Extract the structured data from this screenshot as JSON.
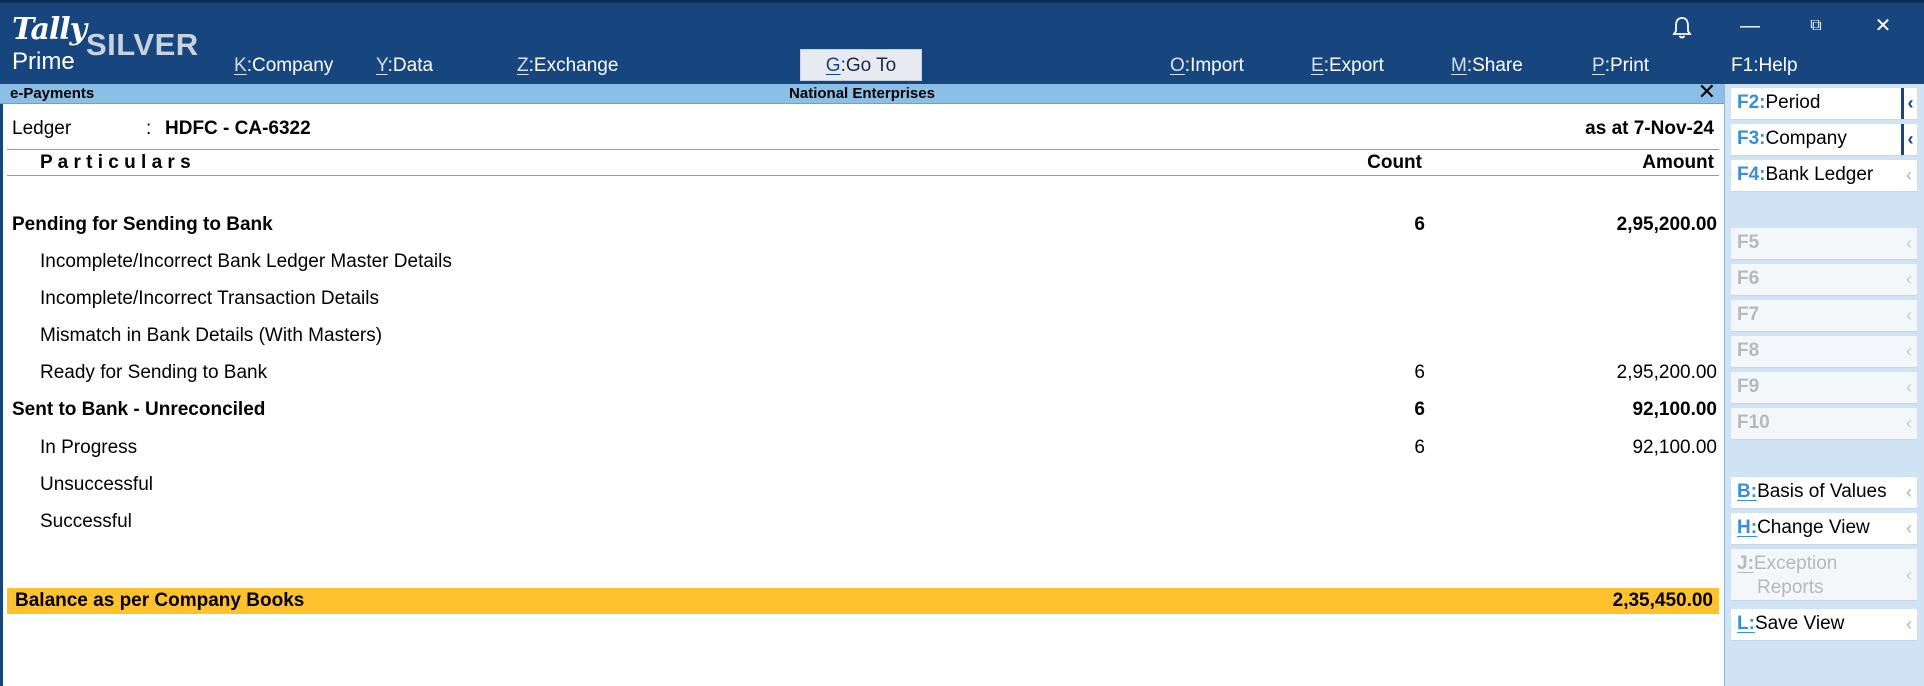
{
  "app": {
    "brand_top": "Tally",
    "brand_bottom": "Prime",
    "edition": "SILVER"
  },
  "window_controls": {
    "minimize": "—",
    "restore": "⧉",
    "close": "✕"
  },
  "menu": [
    {
      "key": "K",
      "label": "Company"
    },
    {
      "key": "Y",
      "label": "Data"
    },
    {
      "key": "Z",
      "label": "Exchange"
    },
    {
      "key": "G",
      "label": "Go To"
    },
    {
      "key": "O",
      "label": "Import"
    },
    {
      "key": "E",
      "label": "Export"
    },
    {
      "key": "M",
      "label": "Share"
    },
    {
      "key": "P",
      "label": "Print"
    },
    {
      "key": "F1",
      "label": "Help"
    }
  ],
  "titlebar": {
    "report": "e-Payments",
    "company": "National Enterprises",
    "close": "✕"
  },
  "ledger": {
    "label": "Ledger",
    "sep": ":",
    "value": "HDFC - CA-6322",
    "as_at": "as at 7-Nov-24"
  },
  "columns": {
    "particulars": "P a r t i c u l a r s",
    "count": "Count",
    "amount": "Amount"
  },
  "rows": [
    {
      "label": "Pending for Sending to Bank",
      "count": "6",
      "amount": "2,95,200.00"
    },
    {
      "label": "Incomplete/Incorrect Bank Ledger Master Details",
      "count": "",
      "amount": ""
    },
    {
      "label": "Incomplete/Incorrect Transaction Details",
      "count": "",
      "amount": ""
    },
    {
      "label": "Mismatch in Bank Details (With Masters)",
      "count": "",
      "amount": ""
    },
    {
      "label": "Ready for Sending to Bank",
      "count": "6",
      "amount": "2,95,200.00"
    },
    {
      "label": "Sent to Bank - Unreconciled",
      "count": "6",
      "amount": "92,100.00"
    },
    {
      "label": "In Progress",
      "count": "6",
      "amount": "92,100.00"
    },
    {
      "label": "Unsuccessful",
      "count": "",
      "amount": ""
    },
    {
      "label": "Successful",
      "count": "",
      "amount": ""
    }
  ],
  "total": {
    "label": "Balance as per Company Books",
    "amount": "2,35,450.00"
  },
  "sidebar": [
    {
      "key": "F2:",
      "label": "Period",
      "arrow": "‹"
    },
    {
      "key": "F3:",
      "label": "Company",
      "arrow": "‹"
    },
    {
      "key": "F4:",
      "label": "Bank Ledger",
      "arrow": "‹"
    },
    {
      "key": "F5",
      "label": "",
      "arrow": "‹"
    },
    {
      "key": "F6",
      "label": "",
      "arrow": "‹"
    },
    {
      "key": "F7",
      "label": "",
      "arrow": "‹"
    },
    {
      "key": "F8",
      "label": "",
      "arrow": "‹"
    },
    {
      "key": "F9",
      "label": "",
      "arrow": "‹"
    },
    {
      "key": "F10",
      "label": "",
      "arrow": "‹"
    },
    {
      "key": "B:",
      "label": "Basis of Values",
      "arrow": "‹"
    },
    {
      "key": "H:",
      "label": "Change View",
      "arrow": "‹"
    },
    {
      "key": "J:",
      "label": "Exception",
      "label2": "Reports",
      "arrow": "‹"
    },
    {
      "key": "L:",
      "label": "Save View",
      "arrow": "‹"
    }
  ],
  "colors": {
    "header": "#17457e",
    "titlebar": "#8bbfe6",
    "total_bg": "#fec22f",
    "sidebar_bg": "#cfe3f4",
    "key_blue": "#3a8fd4"
  }
}
